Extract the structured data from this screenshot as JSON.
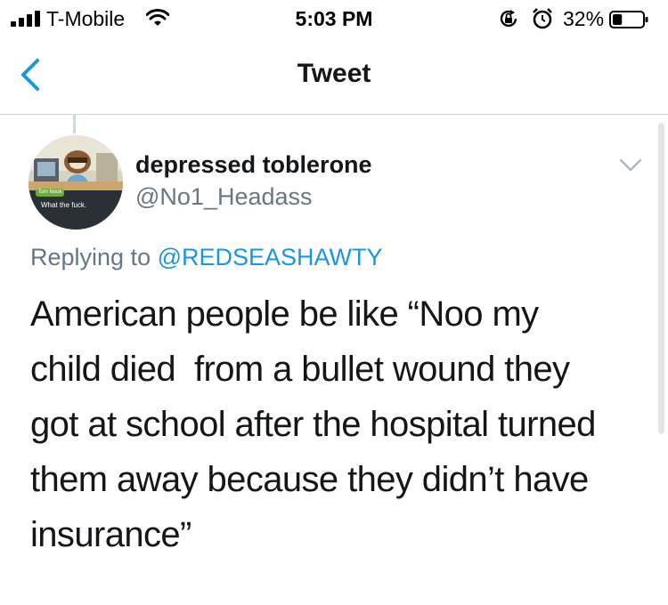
{
  "status_bar": {
    "carrier": "T-Mobile",
    "time": "5:03 PM",
    "battery_percent": "32%",
    "battery_level": 0.32,
    "icons": [
      "signal-icon",
      "wifi-icon",
      "rotation-lock-icon",
      "alarm-icon",
      "battery-icon"
    ]
  },
  "nav": {
    "title": "Tweet",
    "back_icon": "chevron-left-icon"
  },
  "tweet": {
    "display_name": "depressed toblerone",
    "handle": "@No1_Headass",
    "avatar": {
      "name_tag": "Tom Nook",
      "caption": "What the fuck."
    },
    "replying_prefix": "Replying to ",
    "replying_to": "@REDSEASHAWTY",
    "text": "American people be like “Noo my\nchild died  from a bullet wound they\ngot at school after the hospital turned\nthem away because they didn’t have\ninsurance”",
    "menu_icon": "chevron-down-icon"
  },
  "colors": {
    "accent": "#1b95e0",
    "secondary_text": "#657786",
    "primary_text": "#14171a",
    "divider": "#cfd4d8"
  }
}
